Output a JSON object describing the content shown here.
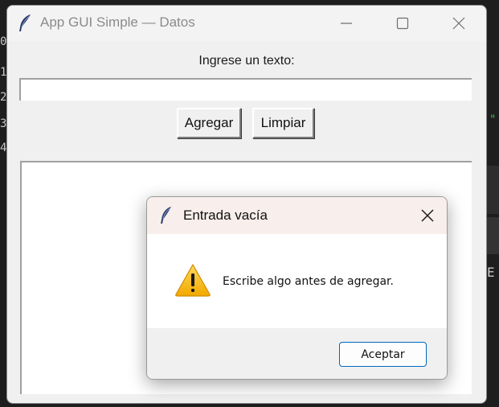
{
  "main_window": {
    "title": "App GUI Simple — Datos",
    "prompt_label": "Ingrese un texto:",
    "entry_value": "",
    "buttons": {
      "add_label": "Agregar",
      "clear_label": "Limpiar"
    },
    "list_items": []
  },
  "dialog": {
    "title": "Entrada vacía",
    "message": "Escribe algo antes de agregar.",
    "ok_label": "Aceptar",
    "icon": "warning-icon"
  },
  "background_editor": {
    "left_chars": [
      "0",
      "1",
      "2",
      "3",
      "4"
    ],
    "right_char_quote": "\"",
    "right_char_e": "E"
  },
  "colors": {
    "dialog_titlebar": "#f8eeeb",
    "accent_button_border": "#0067c0",
    "warning_yellow": "#f6c000"
  }
}
